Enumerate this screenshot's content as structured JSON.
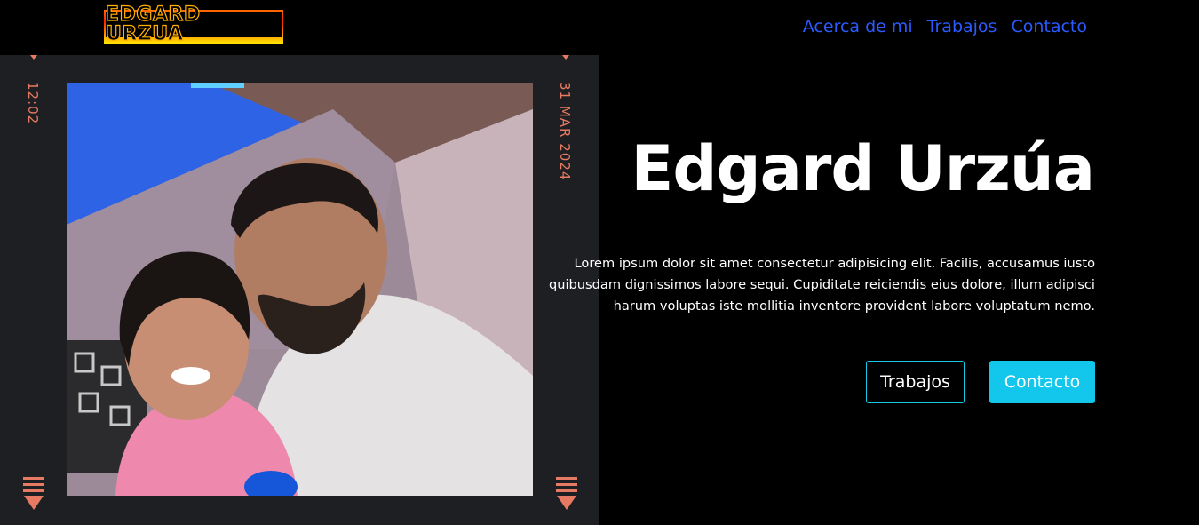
{
  "header": {
    "logo_text": "EDGARD URZUA",
    "nav": [
      {
        "label": "Acerca de mi"
      },
      {
        "label": "Trabajos"
      },
      {
        "label": "Contacto"
      }
    ]
  },
  "photo_frame": {
    "time": "12:02",
    "date": "31 MAR 2024",
    "accent_color": "#e67a63"
  },
  "hero": {
    "title": "Edgard Urzúa",
    "description": "Lorem ipsum dolor sit amet consectetur adipisicing elit. Facilis, accusamus iusto quibusdam dignissimos labore sequi. Cupiditate reiciendis eius dolore, illum adipisci harum voluptas iste mollitia inventore provident labore voluptatum nemo.",
    "buttons": {
      "primary_label": "Trabajos",
      "secondary_label": "Contacto"
    }
  },
  "colors": {
    "background": "#000000",
    "nav_link": "#2a5bff",
    "button_accent": "#12c6ec"
  }
}
